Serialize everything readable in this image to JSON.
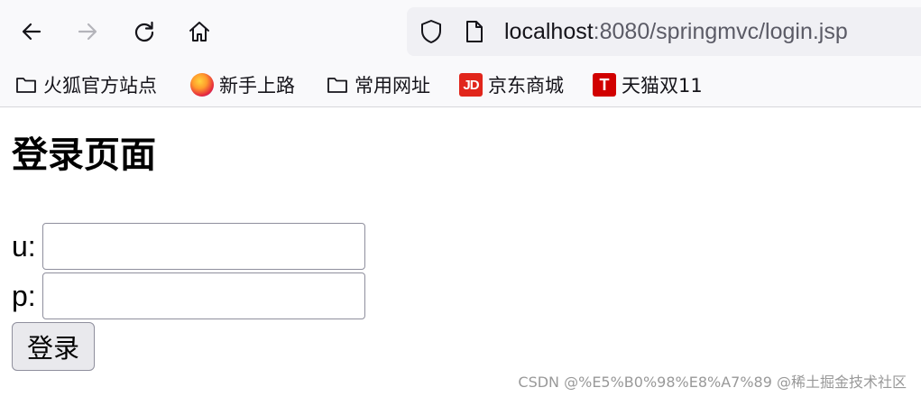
{
  "browser": {
    "nav": {
      "back_icon": "arrow-left-icon",
      "forward_icon": "arrow-right-icon",
      "reload_icon": "reload-icon",
      "home_icon": "home-icon"
    },
    "urlbar": {
      "shield_icon": "shield-icon",
      "page_icon": "page-icon",
      "host": "localhost",
      "path": ":8080/springmvc/login.jsp"
    },
    "bookmarks": [
      {
        "label": "火狐官方站点",
        "icon": "folder-icon"
      },
      {
        "label": "新手上路",
        "icon": "firefox-icon"
      },
      {
        "label": "常用网址",
        "icon": "folder-icon"
      },
      {
        "label": "京东商城",
        "icon": "jd-icon",
        "badge": "JD"
      },
      {
        "label": "天猫双11",
        "icon": "tmall-icon",
        "badge": "T"
      }
    ]
  },
  "page": {
    "title": "登录页面",
    "form": {
      "username_label": "u:",
      "username_value": "",
      "password_label": "p:",
      "password_value": "",
      "submit_label": "登录"
    }
  },
  "watermark": "CSDN @%E5%B0%98%E8%A7%89 @稀土掘金技术社区",
  "colors": {
    "chrome_bg": "#f9f9fb",
    "urlbar_bg": "#f0f0f4",
    "jd_red": "#e1251b",
    "tmall_red": "#d10000"
  }
}
